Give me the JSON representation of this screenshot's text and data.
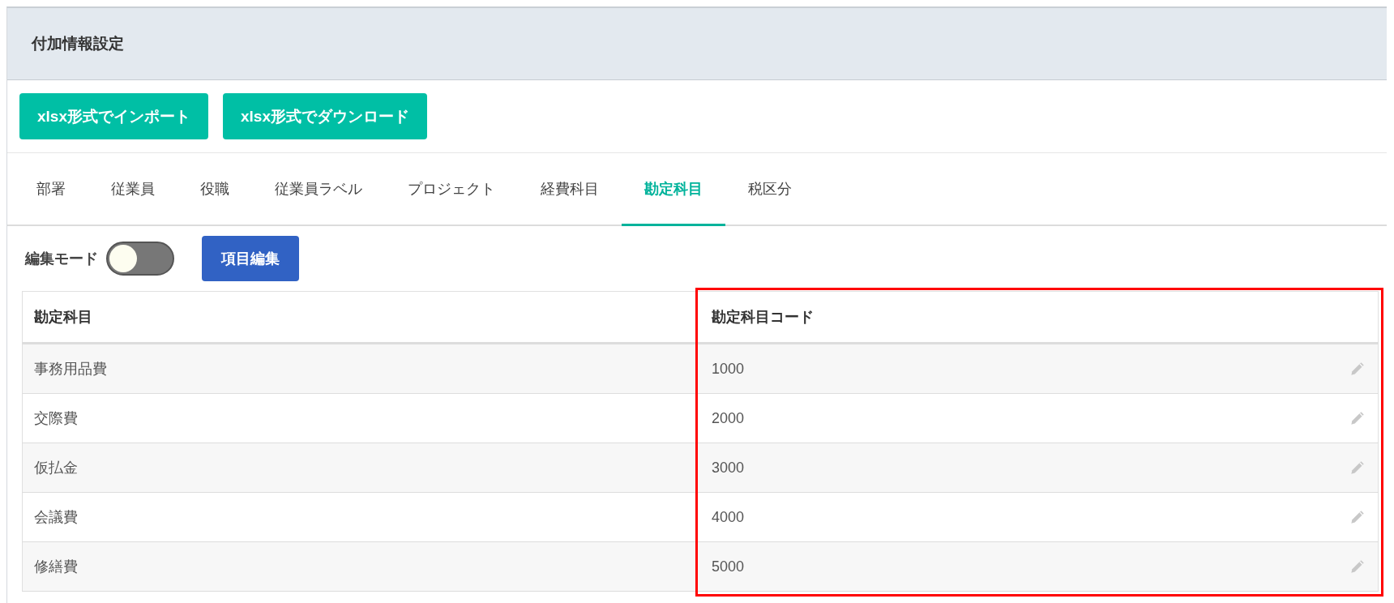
{
  "panel": {
    "title": "付加情報設定"
  },
  "actions": [
    {
      "label": "xlsx形式でインポート"
    },
    {
      "label": "xlsx形式でダウンロード"
    }
  ],
  "tabs": [
    {
      "label": "部署",
      "selected": false
    },
    {
      "label": "従業員",
      "selected": false
    },
    {
      "label": "役職",
      "selected": false
    },
    {
      "label": "従業員ラベル",
      "selected": false
    },
    {
      "label": "プロジェクト",
      "selected": false
    },
    {
      "label": "経費科目",
      "selected": false
    },
    {
      "label": "勘定科目",
      "selected": true
    },
    {
      "label": "税区分",
      "selected": false
    }
  ],
  "edit_mode": {
    "label": "編集モード",
    "on": false
  },
  "edit_items_button": "項目編集",
  "table": {
    "columns": [
      {
        "label": "勘定科目",
        "highlighted": false
      },
      {
        "label": "勘定科目コード",
        "highlighted": true
      }
    ],
    "rows": [
      {
        "name": "事務用品費",
        "code": "1000"
      },
      {
        "name": "交際費",
        "code": "2000"
      },
      {
        "name": "仮払金",
        "code": "3000"
      },
      {
        "name": "会議費",
        "code": "4000"
      },
      {
        "name": "修繕費",
        "code": "5000"
      }
    ]
  }
}
